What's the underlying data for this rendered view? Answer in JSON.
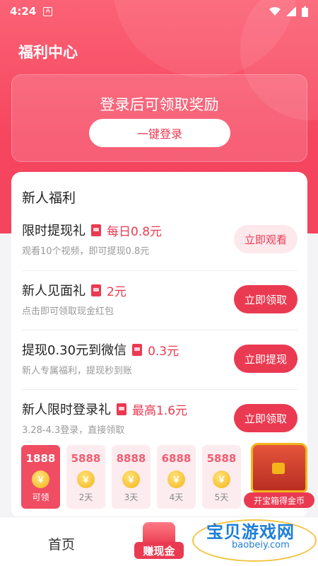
{
  "status": {
    "time": "4:24",
    "a_badge": "A"
  },
  "header": {
    "title": "福利中心"
  },
  "login": {
    "prompt": "登录后可领取奖励",
    "button": "一键登录"
  },
  "newcomer": {
    "title": "新人福利",
    "items": [
      {
        "name": "限时提现礼",
        "reward": "每日0.8元",
        "desc": "观看10个视频，即可提现0.8元",
        "button": "立即观看",
        "style": "soft"
      },
      {
        "name": "新人见面礼",
        "reward": "2元",
        "desc": "点击即可领取现金红包",
        "button": "立即领取",
        "style": "solid"
      },
      {
        "name": "提现0.30元到微信",
        "reward": "0.3元",
        "desc": "新人专属福利，提现秒到账",
        "button": "立即提现",
        "style": "solid"
      },
      {
        "name": "新人限时登录礼",
        "reward": "最高1.6元",
        "desc": "3.28-4.3登录，直接领取",
        "button": "立即领取",
        "style": "solid"
      }
    ]
  },
  "checkin": {
    "days": [
      {
        "coins": "1888",
        "label": "可领",
        "active": true
      },
      {
        "coins": "5888",
        "label": "2天"
      },
      {
        "coins": "8888",
        "label": "3天"
      },
      {
        "coins": "6888",
        "label": "4天"
      },
      {
        "coins": "5888",
        "label": "5天"
      }
    ],
    "coin_glyph": "￥"
  },
  "chest": {
    "label": "开宝箱得金币"
  },
  "tabbar": {
    "home": "首页",
    "earn": "赚现金"
  },
  "watermark": {
    "text": "宝贝游戏网",
    "url": "baobeiy.com"
  },
  "colors": {
    "brand": "#ea3a51",
    "hero_top": "#fb6275"
  }
}
